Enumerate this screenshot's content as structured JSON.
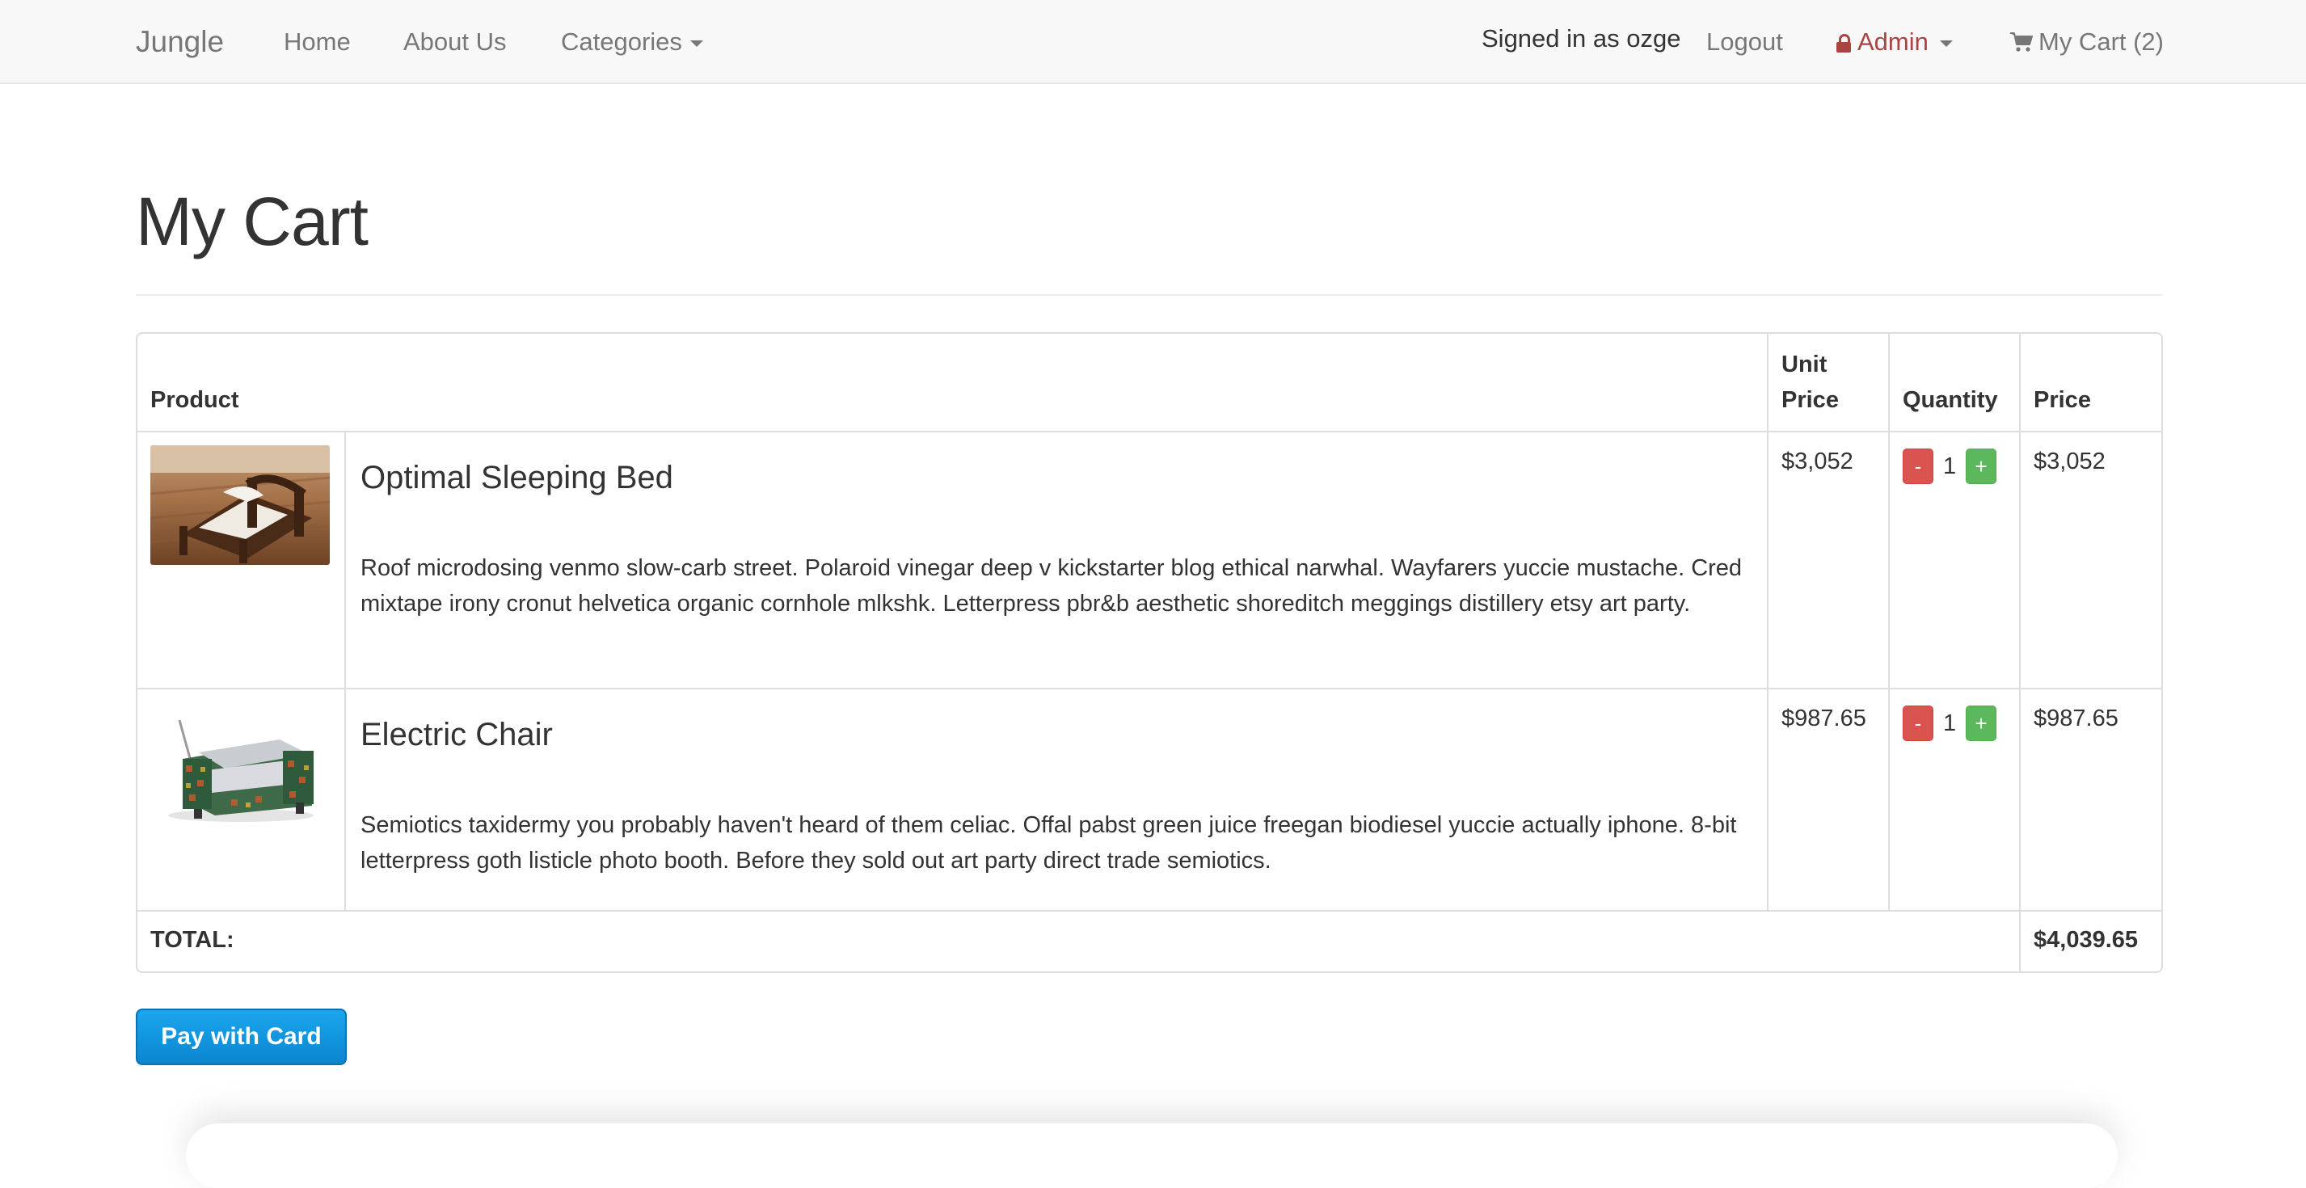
{
  "nav": {
    "brand": "Jungle",
    "home": "Home",
    "about": "About Us",
    "categories": "Categories",
    "signed_in": "Signed in as ozge",
    "logout": "Logout",
    "admin": "Admin",
    "cart": "My Cart (2)"
  },
  "page": {
    "title": "My Cart"
  },
  "table": {
    "headers": {
      "product": "Product",
      "unit_price": "Unit Price",
      "quantity": "Quantity",
      "price": "Price"
    },
    "rows": [
      {
        "name": "Optimal Sleeping Bed",
        "description": "Roof microdosing venmo slow-carb street. Polaroid vinegar deep v kickstarter blog ethical narwhal. Wayfarers yuccie mustache. Cred mixtape irony cronut helvetica organic cornhole mlkshk. Letterpress pbr&b aesthetic shoreditch meggings distillery etsy art party.",
        "unit_price": "$3,052",
        "quantity": "1",
        "price": "$3,052",
        "minus": "-",
        "plus": "+"
      },
      {
        "name": "Electric Chair",
        "description": "Semiotics taxidermy you probably haven't heard of them celiac. Offal pabst green juice freegan biodiesel yuccie actually iphone. 8-bit letterpress goth listicle photo booth. Before they sold out art party direct trade semiotics.",
        "unit_price": "$987.65",
        "quantity": "1",
        "price": "$987.65",
        "minus": "-",
        "plus": "+"
      }
    ],
    "total_label": "TOTAL:",
    "total_value": "$4,039.65"
  },
  "pay_button": "Pay with Card",
  "colors": {
    "admin": "#a94442",
    "minus": "#d9534f",
    "plus": "#5cb85c",
    "pay": "#1a96e0"
  }
}
